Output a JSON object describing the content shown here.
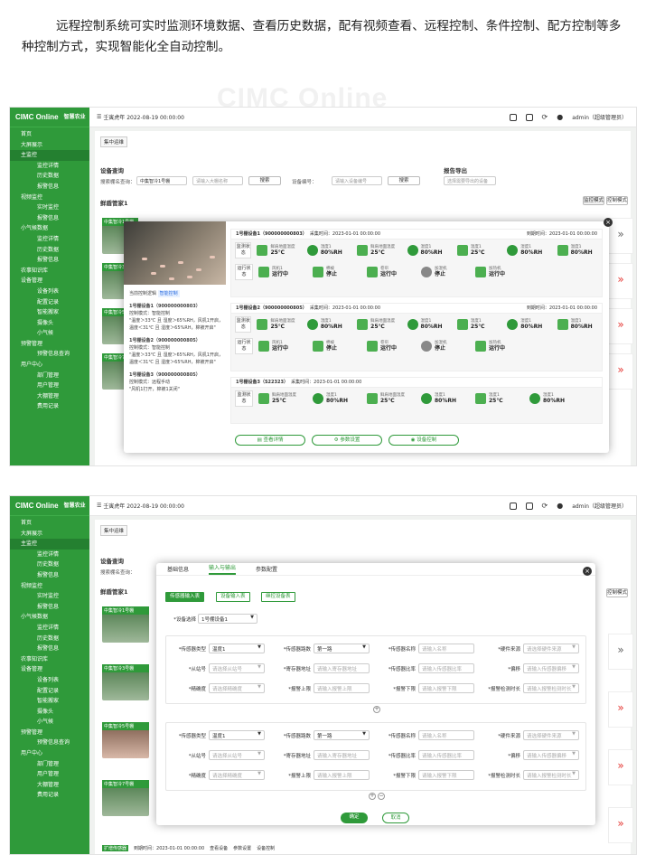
{
  "intro_text": "远程控制系统可实时监测环境数据、查看历史数据，配有视频查看、远程控制、条件控制、配方控制等多种控制方式，实现智能化全自动控制。",
  "watermark": "CIMC Online",
  "colors": {
    "brand_green": "#2f9a3a",
    "alert_red": "#e53935"
  },
  "app": {
    "logo": "CIMC Online",
    "logo_sub": "中 / 集 / 在 / 线",
    "logo_tag": "智慧农业",
    "topbar_date": "壬寅虎年 2022-08-19 00:00:00",
    "user": "admin（超级管理员）",
    "tag_button": "集中运维"
  },
  "nav": [
    {
      "label": "首页",
      "level": "top"
    },
    {
      "label": "大屏展示",
      "level": "top"
    },
    {
      "label": "主监控",
      "level": "top",
      "active": true
    },
    {
      "label": "监控详情",
      "level": "sub"
    },
    {
      "label": "历史数据",
      "level": "sub"
    },
    {
      "label": "报警信息",
      "level": "sub"
    },
    {
      "label": "视频监控",
      "level": "top"
    },
    {
      "label": "实时监控",
      "level": "sub"
    },
    {
      "label": "报警信息",
      "level": "sub"
    },
    {
      "label": "小气候数据",
      "level": "top"
    },
    {
      "label": "监控详情",
      "level": "sub"
    },
    {
      "label": "历史数据",
      "level": "sub"
    },
    {
      "label": "报警信息",
      "level": "sub"
    },
    {
      "label": "农事知识库",
      "level": "top"
    },
    {
      "label": "设备管理",
      "level": "top"
    },
    {
      "label": "设备列表",
      "level": "sub"
    },
    {
      "label": "配置记录",
      "level": "sub"
    },
    {
      "label": "智能搬家",
      "level": "sub"
    },
    {
      "label": "摄像头",
      "level": "sub"
    },
    {
      "label": "小气候",
      "level": "sub"
    },
    {
      "label": "预警管理",
      "level": "top"
    },
    {
      "label": "预警信息查询",
      "level": "sub"
    },
    {
      "label": "用户中心",
      "level": "top"
    },
    {
      "label": "部门管理",
      "level": "sub"
    },
    {
      "label": "用户管理",
      "level": "sub"
    },
    {
      "label": "大棚管理",
      "level": "sub"
    },
    {
      "label": "费用记录",
      "level": "sub"
    }
  ],
  "query": {
    "title": "设备查询",
    "name_label": "搜索棚名查询：",
    "name_value": "中集智冷1号棚",
    "input_placeholder": "请输入大棚名称",
    "search": "搜索",
    "device_no_label": "设备编号：",
    "device_no_placeholder": "请输入设备编号",
    "report_title": "报告导出",
    "report_placeholder": "选择需要导出的设备",
    "shed_title": "鲜盾管家1",
    "mode_a": "监控模式",
    "mode_b": "控制模式"
  },
  "modal1": {
    "logic_label": "当前控制逻辑",
    "logic_tag": "智能控制",
    "rules": [
      {
        "title": "1号棚设备1（900000000803）",
        "mode": "控制模式：智能控制",
        "desc": "\"温度＞33℃ 且 湿度＞65%RH，风机1开启，温度＜31℃ 且 湿度＞65%RH，棉被开启\""
      },
      {
        "title": "1号棚设备2（900000000805）",
        "mode": "控制模式：智能控制",
        "desc": "\"温度＞33℃ 且 湿度＞65%RH，风机1开启，温度＜31℃ 且 湿度＞65%RH，棉被开启\""
      },
      {
        "title": "1号棚设备3（900000000805）",
        "mode": "控制模式：远程手动",
        "desc": "\"风机1打开，棉被1关闭\""
      }
    ],
    "devices": [
      {
        "name": "1号棚设备1（900000000803）",
        "time": "采集时间：2023-01-01 00:00:00",
        "due": "到期时间：2023-01-01 00:00:00",
        "mon": [
          [
            "鲜肩地面温度",
            "25℃"
          ],
          [
            "湿度1",
            "80%RH"
          ],
          [
            "鲜肩地面温度",
            "25℃"
          ],
          [
            "湿度1",
            "80%RH"
          ],
          [
            "温度1",
            "25℃"
          ],
          [
            "湿度1",
            "80%RH"
          ],
          [
            "温度1",
            "80%RH"
          ]
        ],
        "run": [
          [
            "风机1",
            "运行中"
          ],
          [
            "棉被",
            "停止"
          ],
          [
            "卷帘",
            "运行中"
          ],
          [
            "加湿机",
            "停止"
          ],
          [
            "加热机",
            "运行中"
          ]
        ]
      },
      {
        "name": "1号棚设备2（900000000805）",
        "time": "采集时间：2023-01-01 00:00:00",
        "due": "到期时间：2023-01-01 00:00:00",
        "mon": [
          [
            "鲜肩地面温度",
            "25℃"
          ],
          [
            "湿度1",
            "80%RH"
          ],
          [
            "鲜肩地面温度",
            "25℃"
          ],
          [
            "湿度1",
            "80%RH"
          ],
          [
            "温度1",
            "25℃"
          ],
          [
            "湿度1",
            "80%RH"
          ],
          [
            "温度1",
            "80%RH"
          ]
        ],
        "run": [
          [
            "风机1",
            "运行中"
          ],
          [
            "棉被",
            "停止"
          ],
          [
            "卷帘",
            "运行中"
          ],
          [
            "加湿机",
            "停止"
          ],
          [
            "加热机",
            "运行中"
          ]
        ]
      },
      {
        "name": "1号棚设备3（S22323）",
        "time": "采集时间：2023-01-01 00:00:00",
        "due": "",
        "mon": [
          [
            "鲜肩地面温度",
            "25℃"
          ],
          [
            "湿度1",
            "80%RH"
          ],
          [
            "鲜肩地面温度",
            "25℃"
          ],
          [
            "湿度1",
            "80%RH"
          ],
          [
            "温度1",
            "25℃"
          ],
          [
            "湿度1",
            "80%RH"
          ]
        ],
        "run": []
      }
    ],
    "mon_label": "监测状态",
    "run_label": "运行状态",
    "btn_detail": "查看详情",
    "btn_params": "参数设置",
    "btn_control": "设备控制"
  },
  "cards": {
    "names": [
      "中集智冷1号棚",
      "中集智冷3号棚",
      "中集智冷5号棚",
      "中集智冷7号棚"
    ],
    "control_text": "设备控制"
  },
  "modal2": {
    "tabs": [
      "基础信息",
      "输入与输出",
      "参数配置"
    ],
    "sub_tabs": [
      "传感器输入表",
      "设备输入表",
      "继控设备表"
    ],
    "device_select_label": "*设备选择",
    "device_select_value": "1号棚设备1",
    "fields": {
      "sensor_type": "*传感器类型",
      "sensor_type_val": "温度1",
      "channel": "*传感器路数",
      "channel_val": "第一路",
      "name": "*传感器名称",
      "name_ph": "请输入名称",
      "source": "*硬件来源",
      "source_ph": "请选择硬件来源",
      "slave": "*从站号",
      "slave_ph": "请选择从站号",
      "reg_addr": "*寄存器地址",
      "reg_ph": "请输入寄存器地址",
      "ratio": "*传感器比率",
      "ratio_ph": "请输入传感器比率",
      "offset": "*偏移",
      "offset_ph": "请输入传感器偏移",
      "precision": "*精确度",
      "precision_ph": "请选择精确度",
      "up": "*报警上限",
      "up_ph": "请输入报警上限",
      "down": "*报警下限",
      "down_ph": "请输入报警下限",
      "detect": "*报警检测时长",
      "detect_ph": "请输入报警检测时长"
    },
    "ok": "确定",
    "cancel": "取消"
  },
  "footer2": {
    "badge": "扩增传感器",
    "due": "到期时间：2023-01-01 00:00:00",
    "view": "查看设备",
    "params": "参数设置",
    "ctrl": "设备控制"
  }
}
